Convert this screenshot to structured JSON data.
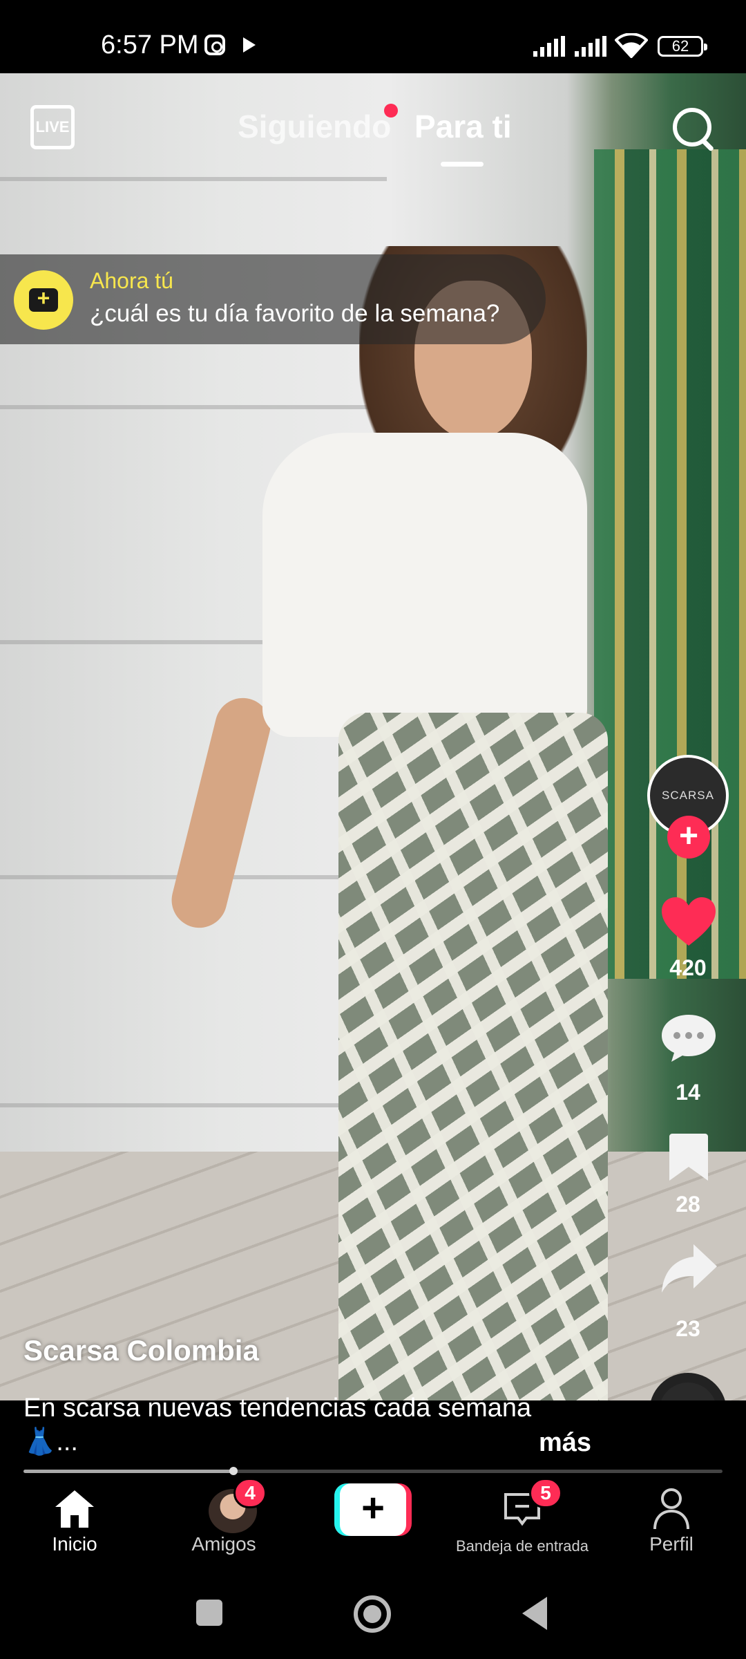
{
  "status_bar": {
    "time": "6:57 PM",
    "battery": "62",
    "icons": [
      "instagram-icon",
      "play-store-icon",
      "signal-icon",
      "signal-icon",
      "wifi-icon",
      "battery-icon"
    ]
  },
  "top_nav": {
    "live_label": "LIVE",
    "tabs": [
      {
        "label": "Siguiendo",
        "active": false,
        "has_dot": true
      },
      {
        "label": "Para ti",
        "active": true
      }
    ],
    "search_icon": "search-icon"
  },
  "prompt": {
    "label": "Ahora tú",
    "question": "¿cuál es tu día favorito de la semana?",
    "icon": "camera-plus-icon"
  },
  "actions": {
    "avatar_text": "SCARSA",
    "likes": "420",
    "comments": "14",
    "saves": "28",
    "shares": "23"
  },
  "post": {
    "author": "Scarsa Colombia",
    "caption_line1": "En scarsa nuevas tendencias cada semana",
    "caption_line2": "👗...",
    "more_label": "más",
    "progress": 0.3
  },
  "bottom_nav": {
    "items": [
      {
        "label": "Inicio",
        "icon": "home-icon",
        "active": true
      },
      {
        "label": "Amigos",
        "icon": "friends-avatar",
        "badge": "4"
      },
      {
        "label": "",
        "icon": "create-icon"
      },
      {
        "label": "Bandeja de entrada",
        "icon": "inbox-icon",
        "badge": "5"
      },
      {
        "label": "Perfil",
        "icon": "profile-icon"
      }
    ]
  },
  "colors": {
    "accent": "#fe2c55",
    "prompt_yellow": "#f7e64d",
    "cyan": "#25f4ee"
  }
}
